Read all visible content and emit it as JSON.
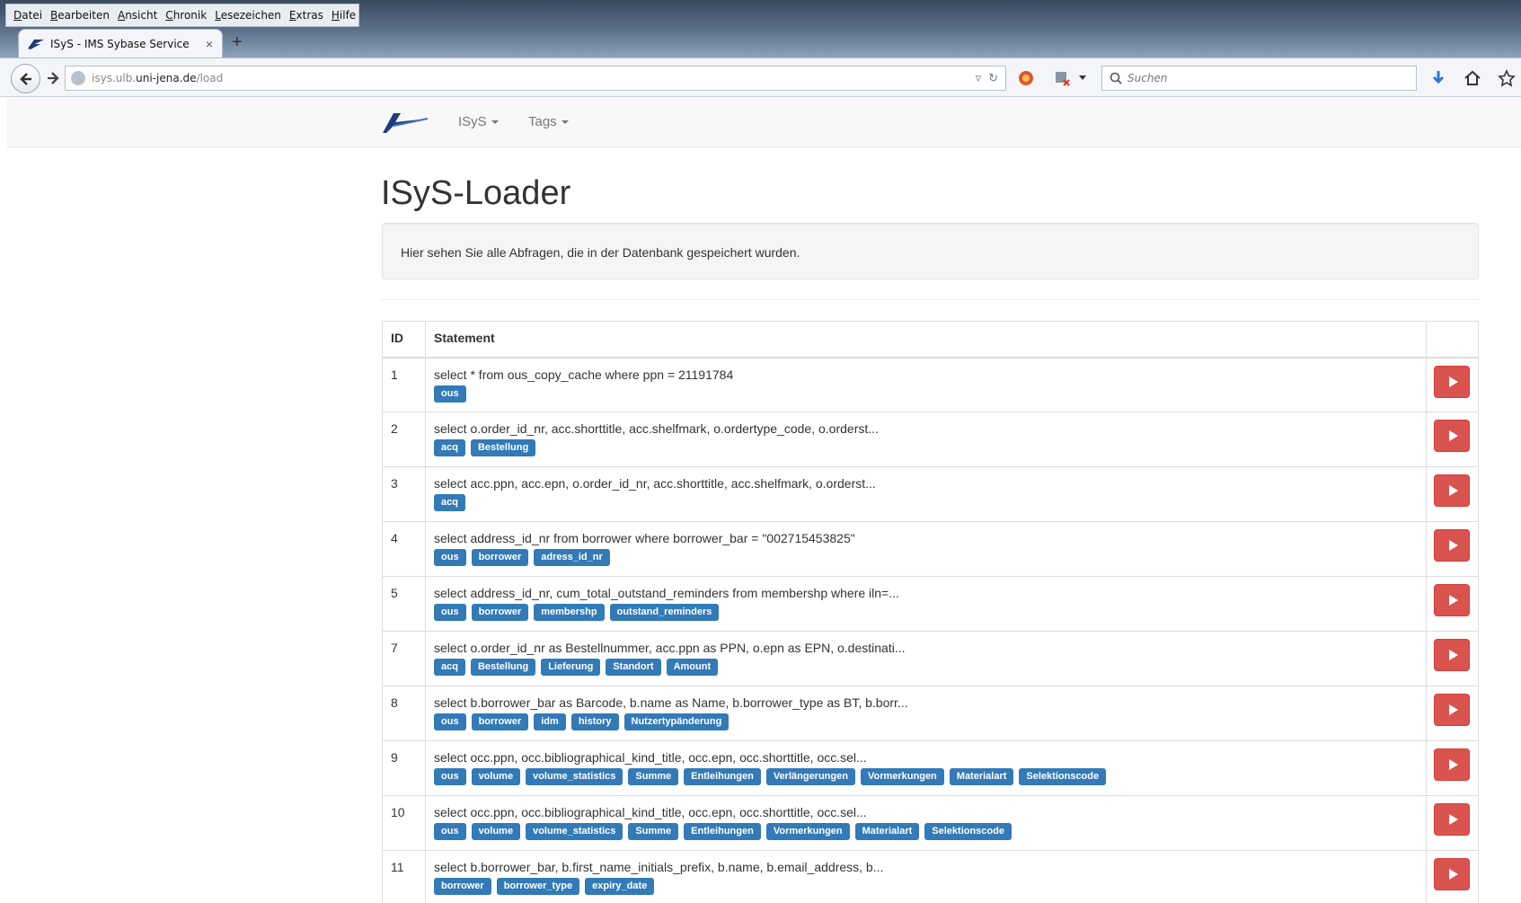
{
  "browser": {
    "menu": [
      "Datei",
      "Bearbeiten",
      "Ansicht",
      "Chronik",
      "Lesezeichen",
      "Extras",
      "Hilfe"
    ],
    "tab_title": "ISyS - IMS Sybase Service",
    "tab_close": "×",
    "new_tab": "+",
    "url_prefix": "isys.ulb.",
    "url_domain": "uni-jena.de",
    "url_path": "/load",
    "search_placeholder": "Suchen"
  },
  "nav": {
    "items": [
      {
        "label": "ISyS"
      },
      {
        "label": "Tags"
      }
    ]
  },
  "page": {
    "title": "ISyS-Loader",
    "info": "Hier sehen Sie alle Abfragen, die in der Datenbank gespeichert wurden."
  },
  "table": {
    "headers": {
      "id": "ID",
      "statement": "Statement",
      "action": ""
    },
    "rows": [
      {
        "id": "1",
        "statement": "select * from ous_copy_cache where ppn = 21191784",
        "tags": [
          "ous"
        ]
      },
      {
        "id": "2",
        "statement": "select o.order_id_nr, acc.shorttitle, acc.shelfmark, o.ordertype_code, o.orderst...",
        "tags": [
          "acq",
          "Bestellung"
        ]
      },
      {
        "id": "3",
        "statement": "select acc.ppn, acc.epn, o.order_id_nr, acc.shorttitle, acc.shelfmark, o.orderst...",
        "tags": [
          "acq"
        ]
      },
      {
        "id": "4",
        "statement": "select address_id_nr from borrower where borrower_bar = \"002715453825\"",
        "tags": [
          "ous",
          "borrower",
          "adress_id_nr"
        ]
      },
      {
        "id": "5",
        "statement": "select address_id_nr, cum_total_outstand_reminders from membershp where iln=...",
        "tags": [
          "ous",
          "borrower",
          "membershp",
          "outstand_reminders"
        ]
      },
      {
        "id": "7",
        "statement": "select o.order_id_nr as Bestellnummer, acc.ppn as PPN, o.epn as EPN, o.destinati...",
        "tags": [
          "acq",
          "Bestellung",
          "Lieferung",
          "Standort",
          "Amount"
        ]
      },
      {
        "id": "8",
        "statement": "select b.borrower_bar as Barcode, b.name as Name, b.borrower_type as BT, b.borr...",
        "tags": [
          "ous",
          "borrower",
          "idm",
          "history",
          "Nutzertypänderung"
        ]
      },
      {
        "id": "9",
        "statement": "select occ.ppn, occ.bibliographical_kind_title, occ.epn, occ.shorttitle, occ.sel...",
        "tags": [
          "ous",
          "volume",
          "volume_statistics",
          "Summe",
          "Entleihungen",
          "Verlängerungen",
          "Vormerkungen",
          "Materialart",
          "Selektionscode"
        ]
      },
      {
        "id": "10",
        "statement": "select occ.ppn, occ.bibliographical_kind_title, occ.epn, occ.shorttitle, occ.sel...",
        "tags": [
          "ous",
          "volume",
          "volume_statistics",
          "Summe",
          "Entleihungen",
          "Vormerkungen",
          "Materialart",
          "Selektionscode"
        ]
      },
      {
        "id": "11",
        "statement": "select b.borrower_bar, b.first_name_initials_prefix, b.name, b.email_address, b...",
        "tags": [
          "borrower",
          "borrower_type",
          "expiry_date"
        ]
      }
    ]
  },
  "colors": {
    "label_bg": "#337ab7",
    "run_button": "#d9534f"
  }
}
